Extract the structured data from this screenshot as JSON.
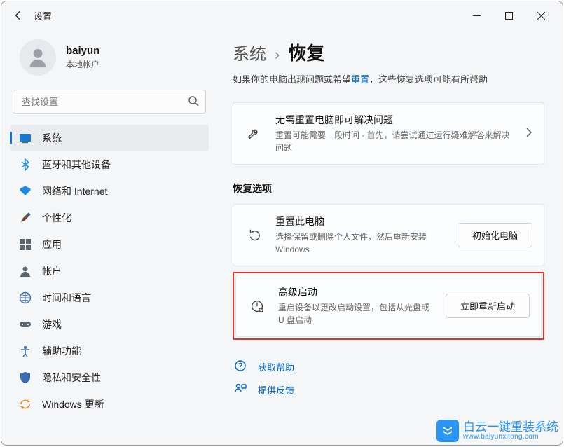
{
  "window": {
    "title": "设置"
  },
  "profile": {
    "name": "baiyun",
    "sub": "本地帐户"
  },
  "search": {
    "placeholder": "查找设置"
  },
  "nav": {
    "items": [
      {
        "label": "系统"
      },
      {
        "label": "蓝牙和其他设备"
      },
      {
        "label": "网络和 Internet"
      },
      {
        "label": "个性化"
      },
      {
        "label": "应用"
      },
      {
        "label": "帐户"
      },
      {
        "label": "时间和语言"
      },
      {
        "label": "游戏"
      },
      {
        "label": "辅助功能"
      },
      {
        "label": "隐私和安全性"
      },
      {
        "label": "Windows 更新"
      }
    ]
  },
  "breadcrumb": {
    "parent": "系统",
    "sep": "›",
    "current": "恢复"
  },
  "intro": {
    "prefix": "如果你的电脑出现问题或希望",
    "link": "重置",
    "suffix": "，这些恢复选项可能有所帮助"
  },
  "troubleshoot": {
    "title": "无需重置电脑即可解决问题",
    "desc": "重置可能需要一段时间 - 首先，请尝试通过运行疑难解答来解决问题"
  },
  "sectionTitle": "恢复选项",
  "reset": {
    "title": "重置此电脑",
    "desc": "选择保留或删除个人文件，然后重新安装 Windows",
    "button": "初始化电脑"
  },
  "advanced": {
    "title": "高级启动",
    "desc": "重启设备以更改启动设置，包括从光盘或 U 盘启动",
    "button": "立即重新启动"
  },
  "links": {
    "help": "获取帮助",
    "feedback": "提供反馈"
  },
  "watermark": {
    "line1": "白云一键重装系统",
    "line2": "www.baiyunxitong.com"
  }
}
